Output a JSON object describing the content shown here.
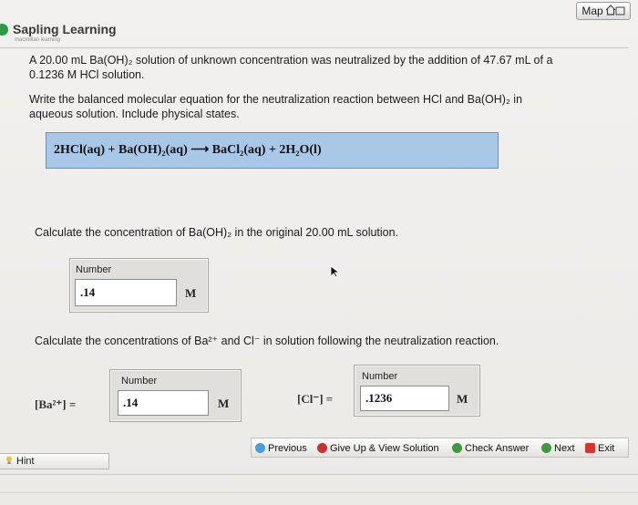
{
  "header": {
    "map_label": "Map",
    "logo_name": "Sapling Learning",
    "logo_sub": "macmillan learning"
  },
  "question": {
    "line1": "A 20.00 mL Ba(OH)₂ solution of unknown concentration was neutralized by the addition of 47.67 mL of a",
    "line2": "0.1236 M HCl solution.",
    "line3": "Write the balanced molecular equation for the neutralization reaction between HCl and Ba(OH)₂ in",
    "line4": "aqueous solution. Include physical states."
  },
  "equation": {
    "text": "2HCl(aq) + Ba(OH)₂(aq)   ⟶   BaCl₂(aq) + 2H₂O(l)"
  },
  "part2": {
    "prompt": "Calculate the concentration of Ba(OH)₂ in the original 20.00 mL solution.",
    "number_label": "Number",
    "value": ".14",
    "unit": "M"
  },
  "part3": {
    "prompt": "Calculate the concentrations of Ba²⁺ and Cl⁻ in solution following the neutralization reaction.",
    "ba": {
      "ion_label": "[Ba²⁺] =",
      "number_label": "Number",
      "value": ".14",
      "unit": "M"
    },
    "cl": {
      "ion_label": "[Cl⁻] =",
      "number_label": "Number",
      "value": ".1236",
      "unit": "M"
    }
  },
  "footer": {
    "hint": "Hint",
    "previous": "Previous",
    "give_up": "Give Up & View Solution",
    "check_answer": "Check Answer",
    "next": "Next",
    "exit": "Exit"
  },
  "colors": {
    "equation_bg": "#a9c7e6",
    "sapling_green": "#2f9a48",
    "give_up_red": "#c9302c",
    "exit_red": "#d9342b"
  }
}
